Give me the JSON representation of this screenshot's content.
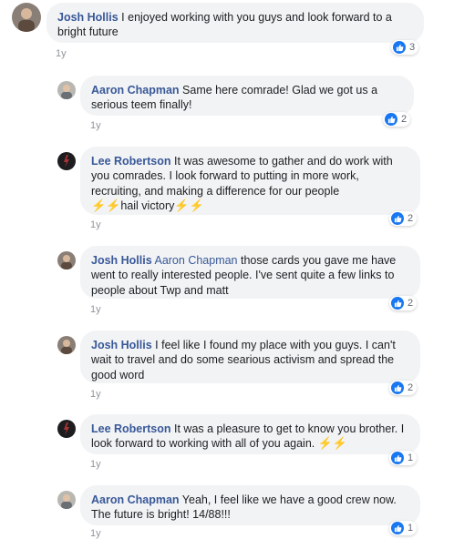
{
  "comments": [
    {
      "author": "Josh Hollis",
      "mention": "",
      "text": "I enjoyed working with you guys and look forward to a bright future",
      "reactions": "3",
      "time": "1y",
      "avatar": "josh-avatar"
    },
    {
      "author": "Aaron Chapman",
      "mention": "",
      "text": "Same here comrade! Glad we got us a serious teem finally!",
      "reactions": "2",
      "time": "1y",
      "avatar": "aaron-avatar"
    },
    {
      "author": "Lee Robertson",
      "mention": "",
      "text": "It was awesome to gather and do work with you comrades. I look forward to putting in more work, recruiting, and making a difference for our people",
      "text_line2": "hail victory",
      "reactions": "2",
      "time": "1y",
      "avatar": "lee-avatar"
    },
    {
      "author": "Josh Hollis",
      "mention": "Aaron Chapman",
      "text": "those cards you gave me have went to really interested people. I've sent quite a few links to people about Twp and matt",
      "reactions": "2",
      "time": "1y",
      "avatar": "josh-avatar"
    },
    {
      "author": "Josh Hollis",
      "mention": "",
      "text": "I feel like I found my place with you guys. I can't wait to travel and do some searious activism and spread the good word",
      "reactions": "2",
      "time": "1y",
      "avatar": "josh-avatar"
    },
    {
      "author": "Lee Robertson",
      "mention": "",
      "text": "It was a pleasure to get to know you brother. I look forward to working with all of you again.",
      "reactions": "1",
      "time": "1y",
      "avatar": "lee-avatar"
    },
    {
      "author": "Aaron Chapman",
      "mention": "",
      "text": "Yeah, I feel like we have a good crew now. The future is bright! 14/88!!!",
      "reactions": "1",
      "time": "1y",
      "avatar": "aaron-avatar"
    }
  ],
  "icons": {
    "reaction": "like-thumb-icon",
    "emoji": "high-voltage-emoji-icon"
  },
  "colors": {
    "author": "#385898",
    "bubble": "#f2f3f5",
    "like": "#1877f2",
    "time": "#90949c"
  }
}
